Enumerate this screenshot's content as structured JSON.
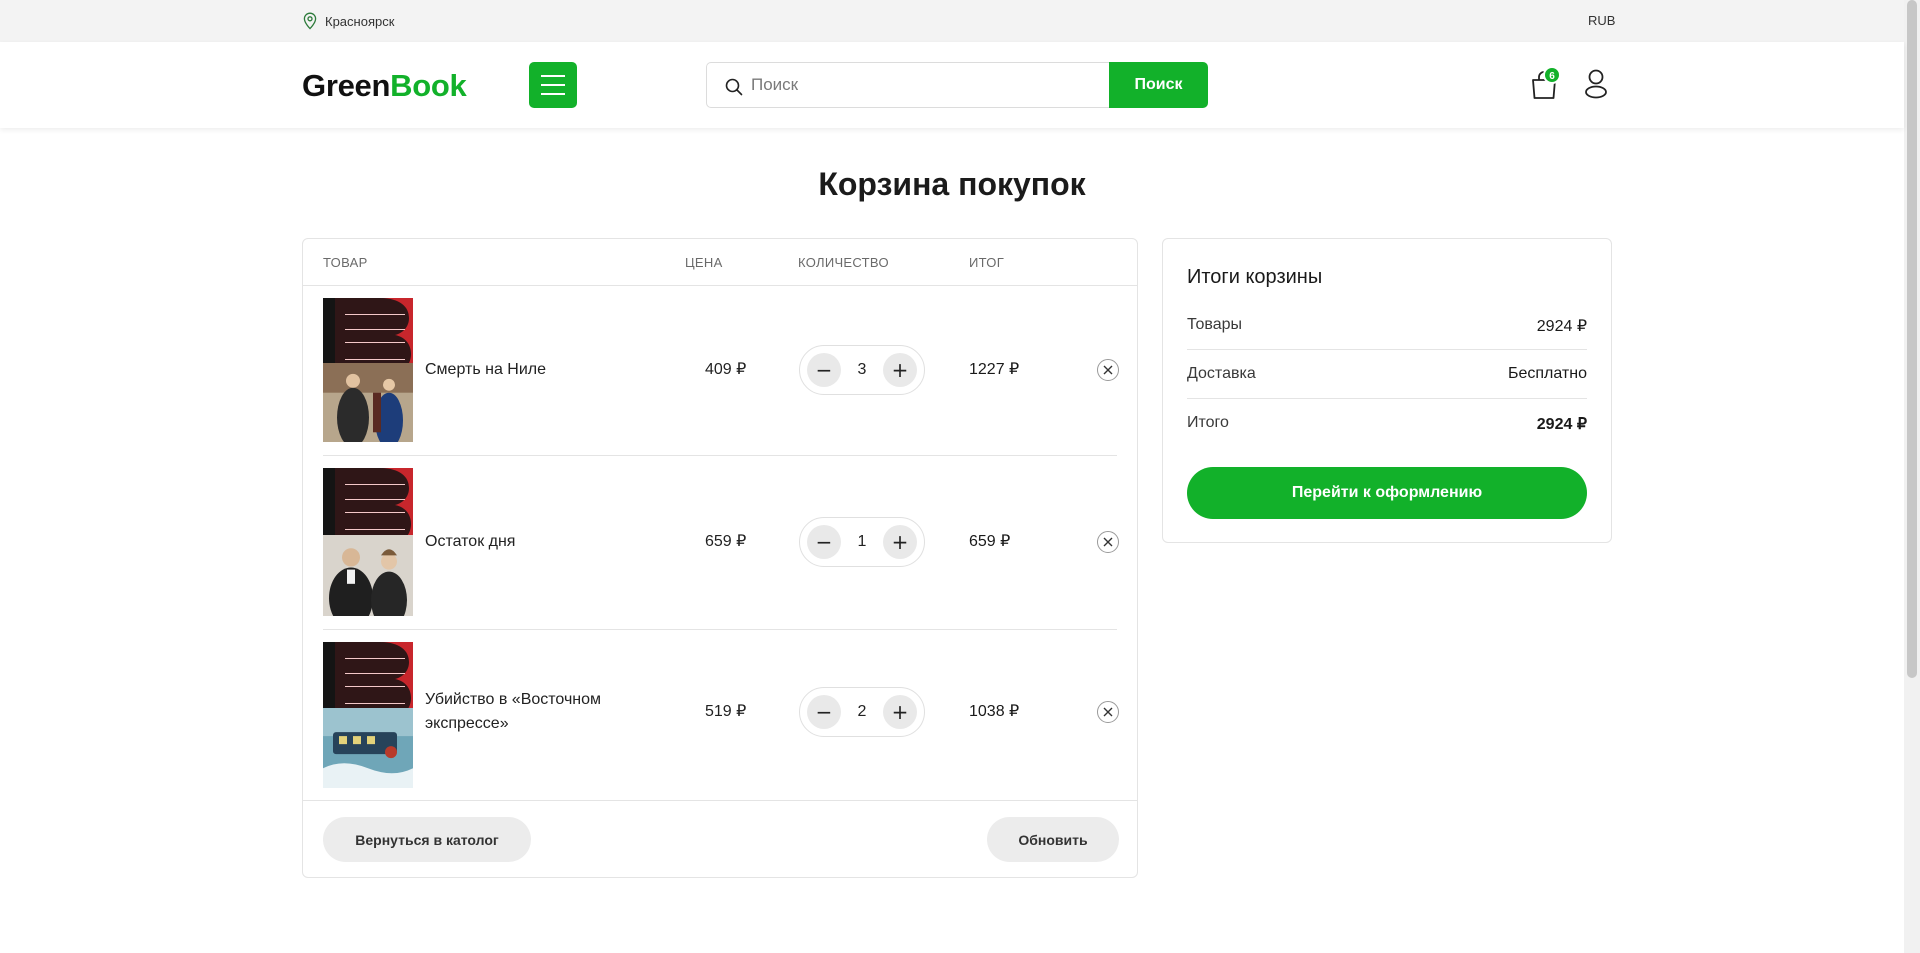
{
  "topbar": {
    "city": "Красноярск",
    "currency": "RUB"
  },
  "header": {
    "logo_part1": "Green",
    "logo_part2": "Book",
    "search_placeholder": "Поиск",
    "search_button": "Поиск",
    "cart_count": "6"
  },
  "page_title": "Корзина покупок",
  "table": {
    "headers": {
      "product": "ТОВАР",
      "price": "ЦЕНА",
      "quantity": "КОЛИЧЕСТВО",
      "total": "ИТОГ"
    },
    "items": [
      {
        "name": "Смерть на Ниле",
        "price": "409 ₽",
        "qty": "3",
        "subtotal": "1227 ₽"
      },
      {
        "name": "Остаток дня",
        "price": "659 ₽",
        "qty": "1",
        "subtotal": "659 ₽"
      },
      {
        "name": "Убийство в «Восточном экспрессе»",
        "price": "519 ₽",
        "qty": "2",
        "subtotal": "1038 ₽"
      }
    ],
    "back_button": "Вернуться в католог",
    "update_button": "Обновить"
  },
  "totals": {
    "title": "Итоги корзины",
    "goods_label": "Товары",
    "goods_value": "2924 ₽",
    "delivery_label": "Доставка",
    "delivery_value": "Бесплатно",
    "total_label": "Итого",
    "total_value": "2924 ₽",
    "checkout_button": "Перейти к оформлению"
  },
  "colors": {
    "accent": "#12b12a",
    "cover_red": "#c8262c"
  },
  "icons": {
    "location": "location-pin-icon",
    "menu": "hamburger-menu-icon",
    "search": "search-icon",
    "cart": "shopping-bag-icon",
    "user": "user-icon",
    "remove": "close-icon"
  }
}
